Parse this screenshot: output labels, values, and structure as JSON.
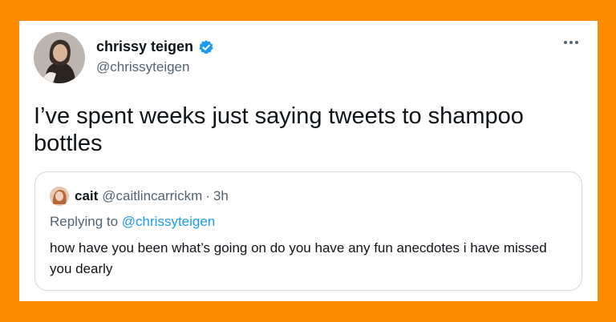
{
  "colors": {
    "background": "#ff8c00",
    "card": "#ffffff",
    "verified": "#1d9bf0",
    "text_primary": "#0f1419",
    "text_secondary": "#536471",
    "border": "#cfd9de"
  },
  "tweet": {
    "author": {
      "display_name": "chrissy teigen",
      "handle": "@chrissyteigen",
      "verified_icon": "verified-badge-icon",
      "avatar": "avatar"
    },
    "more_icon": "more-horizontal-icon",
    "text": "I’ve spent weeks just saying tweets to shampoo bottles"
  },
  "quoted_tweet": {
    "display_name": "cait",
    "handle": "@caitlincarrickm",
    "separator": "·",
    "time": "3h",
    "replying_prefix": "Replying to",
    "replying_to": "@chrissyteigen",
    "text": "how have you been what’s going on do you have any fun anecdotes i have missed you dearly"
  }
}
